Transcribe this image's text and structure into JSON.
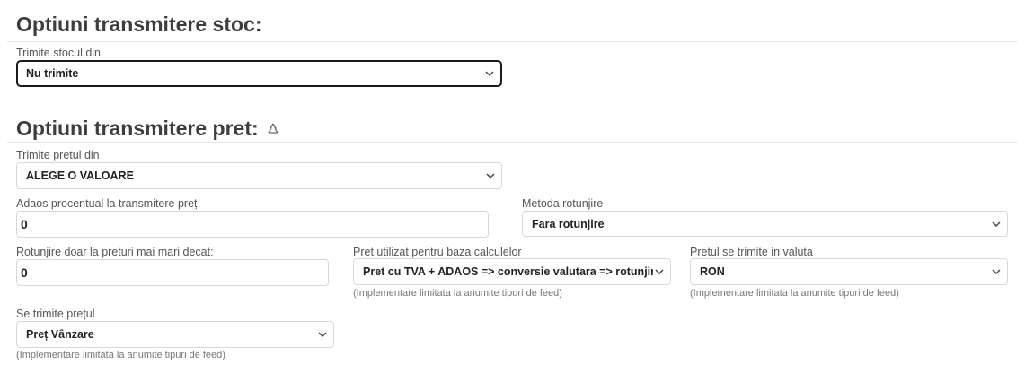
{
  "stock": {
    "heading": "Optiuni transmitere stoc:",
    "source_label": "Trimite stocul din",
    "source_value": "Nu trimite"
  },
  "price": {
    "heading": "Optiuni transmitere pret:",
    "source_label": "Trimite pretul din",
    "source_value": "ALEGE O VALOARE",
    "markup_label": "Adaos procentual la transmitere preț",
    "markup_value": "0",
    "rounding_label": "Metoda rotunjire",
    "rounding_value": "Fara rotunjire",
    "round_only_label": "Rotunjire doar la preturi mai mari decat:",
    "round_only_value": "0",
    "base_label": "Pret utilizat pentru baza calculelor",
    "base_value": "Pret cu TVA + ADAOS => conversie valutara => rotunjire",
    "base_help": "(Implementare limitata la anumite tipuri de feed)",
    "currency_label": "Pretul se trimite in valuta",
    "currency_value": "RON",
    "currency_help": "(Implementare limitata la anumite tipuri de feed)",
    "sent_label": "Se trimite prețul",
    "sent_value": "Preț Vânzare",
    "sent_help": "(Implementare limitata la anumite tipuri de feed)"
  },
  "icons": {
    "heading_icon": "recycle-icon",
    "select_icon": "chevron-down-icon"
  }
}
